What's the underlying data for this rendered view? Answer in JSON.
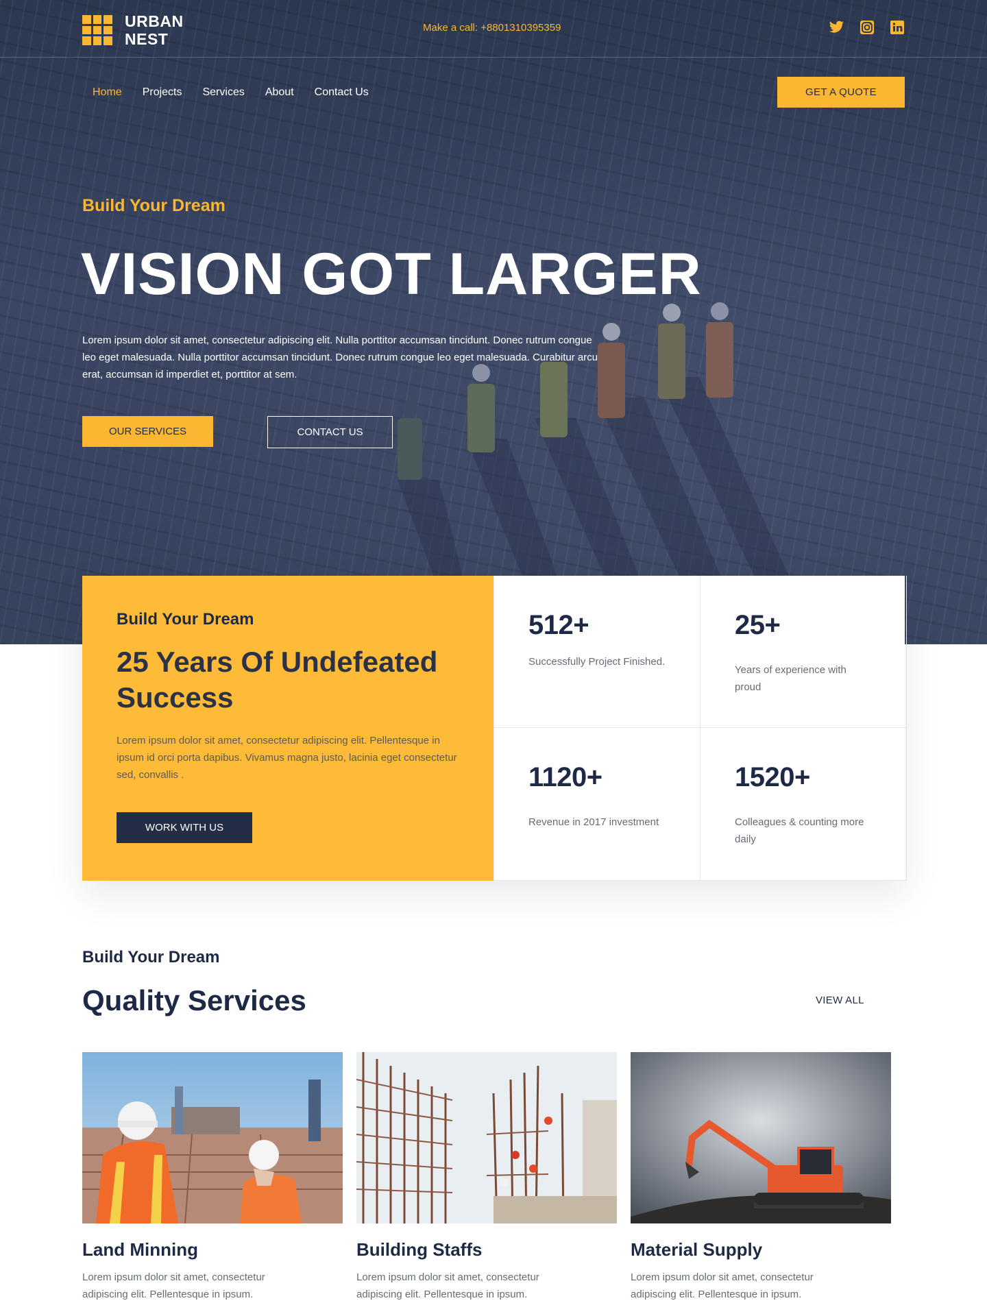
{
  "brand": {
    "name_line1": "URBAN",
    "name_line2": "NEST"
  },
  "topbar": {
    "call_text": "Make a call: +8801310395359"
  },
  "socials": [
    {
      "icon": "twitter-icon"
    },
    {
      "icon": "instagram-icon"
    },
    {
      "icon": "linkedin-icon"
    }
  ],
  "nav": {
    "items": [
      "Home",
      "Projects",
      "Services",
      "About",
      "Contact Us"
    ],
    "active": "Home"
  },
  "header": {
    "quote_label": "GET A QUOTE"
  },
  "hero": {
    "kicker": "Build Your Dream",
    "headline": "VISION GOT LARGER",
    "paragraph": "Lorem ipsum dolor sit amet, consectetur adipiscing elit. Nulla porttitor accumsan tincidunt. Donec rutrum congue leo eget malesuada. Nulla porttitor accumsan tincidunt. Donec rutrum congue leo eget malesuada. Curabitur arcu erat, accumsan id imperdiet et, porttitor at sem.",
    "primary_button": "OUR SERVICES",
    "secondary_button": "CONTACT US"
  },
  "about": {
    "kicker": "Build Your Dream",
    "title": "25 Years Of Undefeated Success",
    "paragraph": "Lorem ipsum dolor sit amet, consectetur adipiscing elit. Pellentesque in ipsum id orci porta dapibus. Vivamus magna justo, lacinia eget consectetur sed, convallis .",
    "button": "WORK WITH US"
  },
  "stats": [
    {
      "value": "512+",
      "label": "Successfully Project Finished."
    },
    {
      "value": "25+",
      "label": "Years of experience with proud"
    },
    {
      "value": "1120+",
      "label": "Revenue in 2017 investment"
    },
    {
      "value": "1520+",
      "label": "Colleagues & counting more daily"
    }
  ],
  "services": {
    "kicker": "Build Your Dream",
    "title": "Quality Services",
    "view_all": "VIEW ALL",
    "cards": [
      {
        "title": "Land Minning",
        "text": "Lorem ipsum dolor sit amet, consectetur adipiscing elit. Pellentesque in ipsum."
      },
      {
        "title": "Building Staffs",
        "text": "Lorem ipsum dolor sit amet, consectetur adipiscing elit. Pellentesque in ipsum."
      },
      {
        "title": "Material Supply",
        "text": "Lorem ipsum dolor sit amet, consectetur adipiscing elit. Pellentesque in ipsum."
      }
    ]
  },
  "colors": {
    "accent": "#fbb632",
    "navy": "#1e2a45",
    "hero_overlay": "#37425d"
  }
}
